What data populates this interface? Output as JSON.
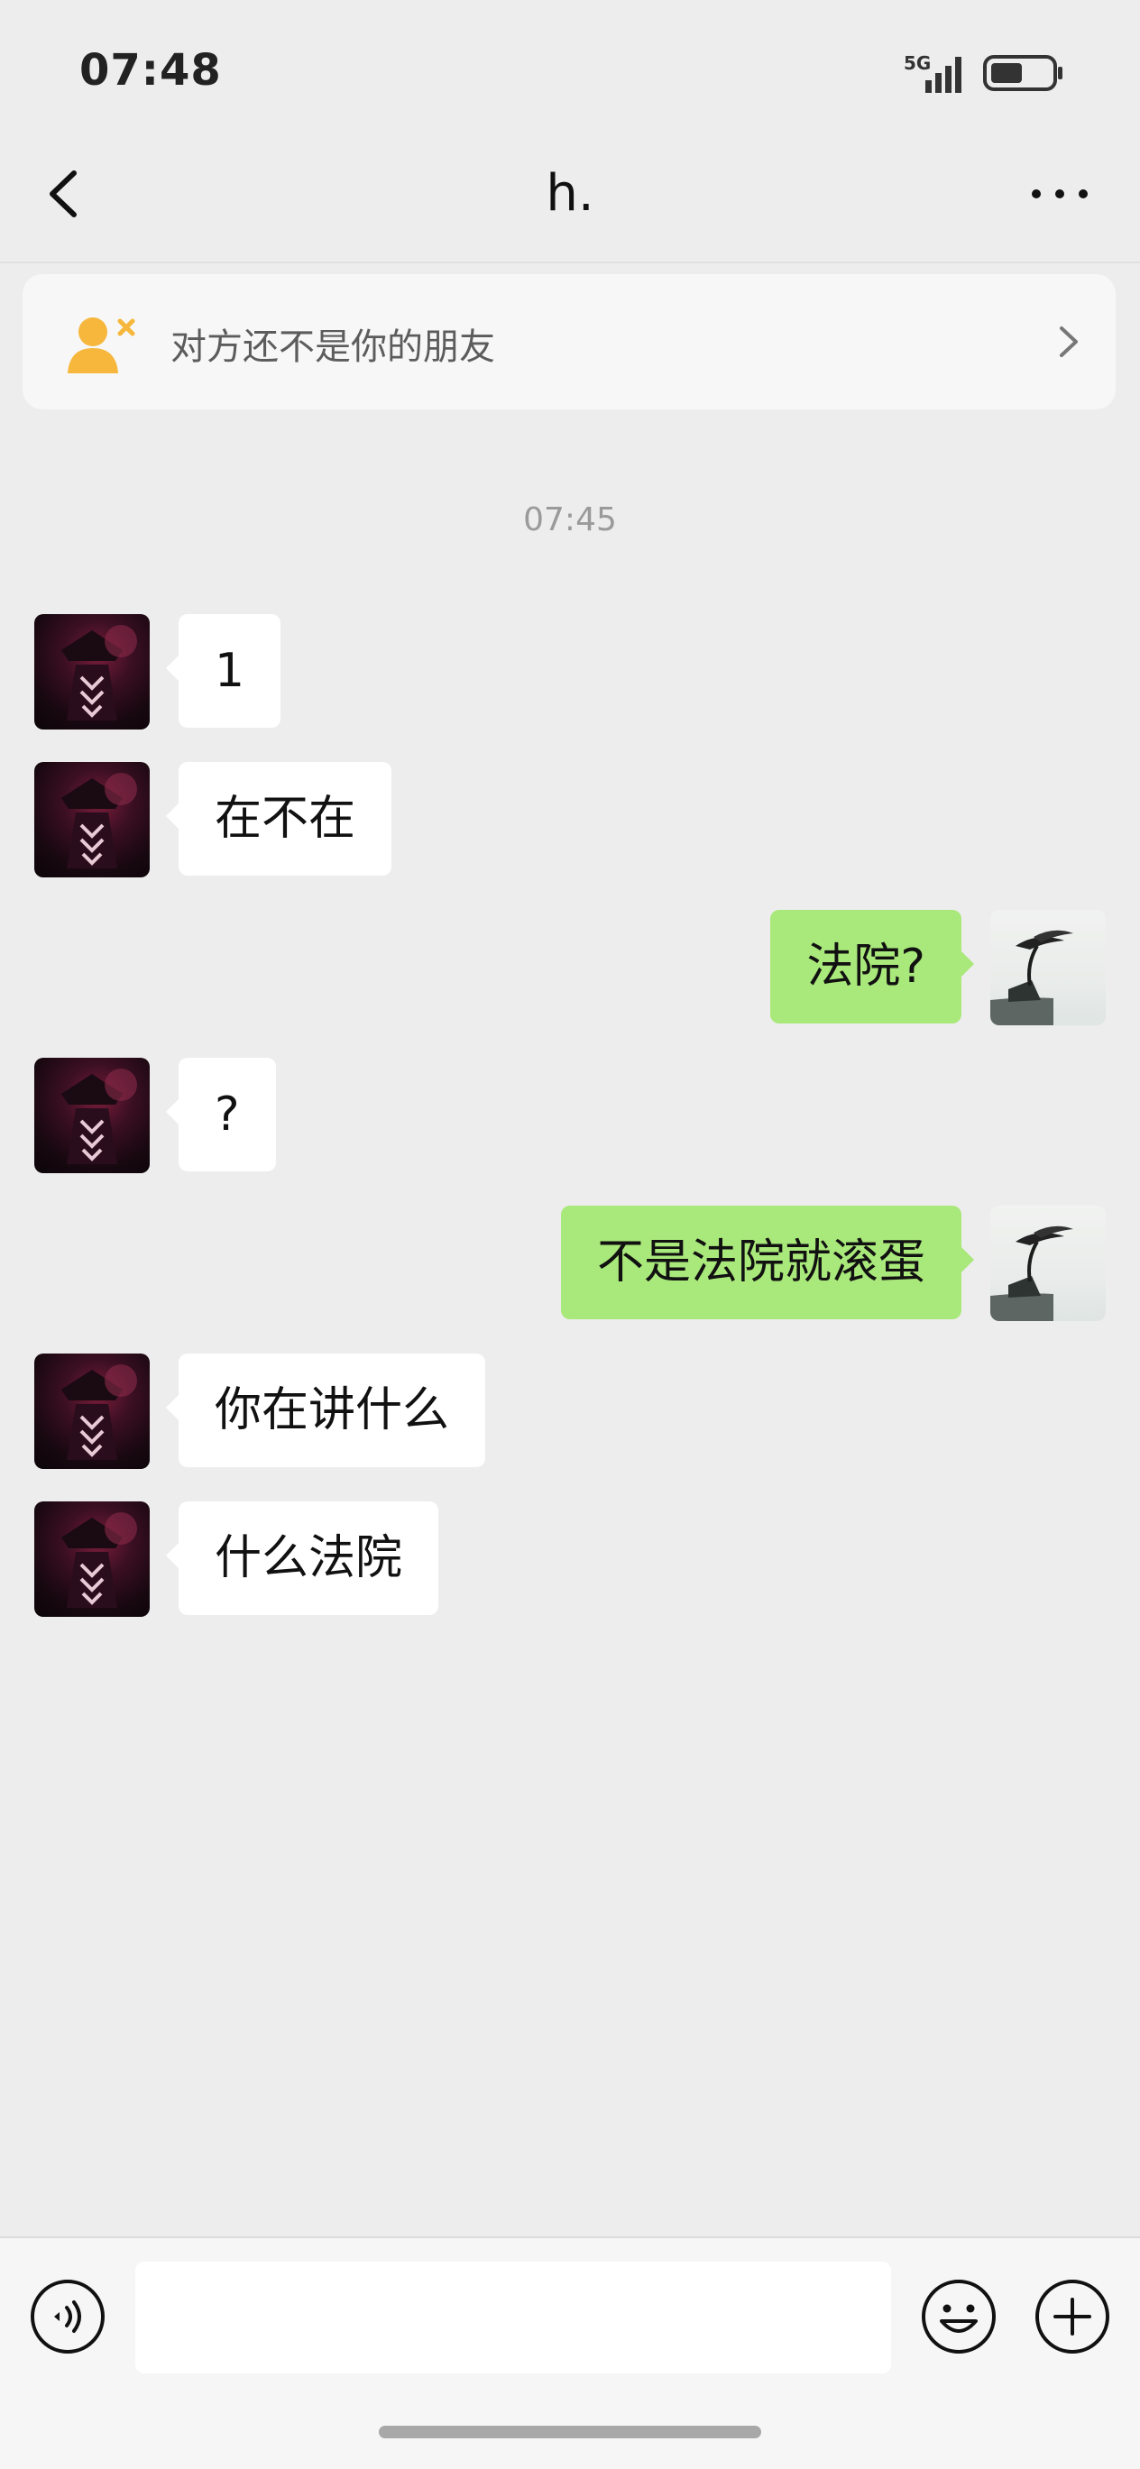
{
  "status_bar": {
    "time": "07:48",
    "network": "5G"
  },
  "header": {
    "title": "h."
  },
  "friend_banner": {
    "text": "对方还不是你的朋友"
  },
  "chat": {
    "timestamp": "07:45",
    "messages": [
      {
        "side": "left",
        "text": "1"
      },
      {
        "side": "left",
        "text": "在不在"
      },
      {
        "side": "right",
        "text": "法院?"
      },
      {
        "side": "left",
        "text": "?"
      },
      {
        "side": "right",
        "text": "不是法院就滚蛋"
      },
      {
        "side": "left",
        "text": "你在讲什么"
      },
      {
        "side": "left",
        "text": "什么法院"
      }
    ]
  },
  "input_bar": {
    "value": "",
    "placeholder": ""
  },
  "colors": {
    "background": "#ededed",
    "bubble_sent": "#a9e87a",
    "bubble_received": "#ffffff",
    "banner_icon": "#f6b73c"
  },
  "icons": {
    "back": "chevron-left-icon",
    "more": "more-dots-icon",
    "add_friend": "user-add-icon",
    "voice": "voice-icon",
    "emoji": "emoji-icon",
    "plus": "plus-icon"
  }
}
